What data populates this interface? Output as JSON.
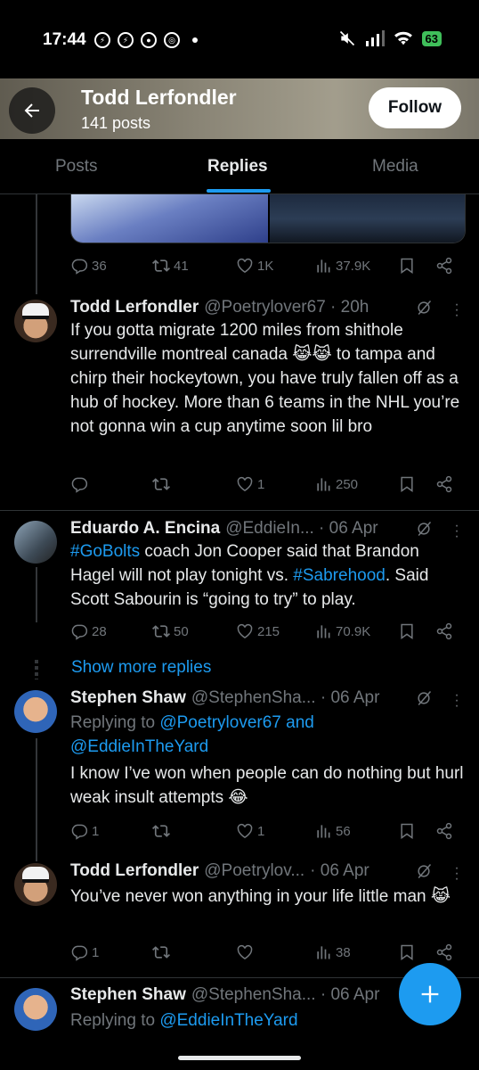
{
  "status_bar": {
    "time": "17:44",
    "battery": "63"
  },
  "header": {
    "name": "Todd Lerfondler",
    "post_count": "141 posts",
    "follow_label": "Follow"
  },
  "tabs": [
    {
      "label": "Posts",
      "active": false
    },
    {
      "label": "Replies",
      "active": true
    },
    {
      "label": "Media",
      "active": false
    }
  ],
  "posts": [
    {
      "stats": {
        "replies": "36",
        "reposts": "41",
        "likes": "1K",
        "views": "37.9K"
      }
    },
    {
      "name": "Todd Lerfondler",
      "handle": "@Poetrylover67 · 20h",
      "text": "If you gotta migrate 1200 miles from shithole surrendville montreal canada 😹😹 to tampa and chirp their hockeytown, you have truly fallen off as a hub of hockey. More than 6 teams in the NHL you’re not gonna win a cup anytime soon lil bro",
      "stats": {
        "replies": "",
        "reposts": "",
        "likes": "1",
        "views": "250"
      }
    },
    {
      "name": "Eduardo A. Encina",
      "handle": "@EddieIn... · 06 Apr",
      "text_parts": {
        "hashtag1": "#GoBolts",
        "part1": " coach Jon Cooper said that Brandon Hagel will not play tonight vs. ",
        "hashtag2": "#Sabrehood",
        "part2": ". Said Scott Sabourin is “going to try” to play."
      },
      "stats": {
        "replies": "28",
        "reposts": "50",
        "likes": "215",
        "views": "70.9K"
      }
    },
    {
      "name": "Stephen Shaw",
      "handle": "@StephenSha... · 06 Apr",
      "replying_prefix": "Replying to ",
      "replying_user1": "@Poetrylover67",
      "replying_and": " and",
      "replying_user2": "@EddieInTheYard",
      "text": "I know I’ve won when people can do nothing but hurl weak insult attempts 😂",
      "stats": {
        "replies": "1",
        "reposts": "",
        "likes": "1",
        "views": "56"
      }
    },
    {
      "name": "Todd Lerfondler",
      "handle": "@Poetrylov...",
      "date": "· 06 Apr",
      "text": "You’ve never won anything in your life little man 😹",
      "stats": {
        "replies": "1",
        "reposts": "",
        "likes": "",
        "views": "38"
      }
    },
    {
      "name": "Stephen Shaw",
      "handle": "@StephenSha... · 06 Apr",
      "replying_prefix": "Replying to ",
      "replying_user": "@EddieInTheYard"
    }
  ],
  "show_more_label": "Show more replies",
  "colors": {
    "accent": "#1d9bf0",
    "muted": "#71767b",
    "text": "#e7e9ea",
    "background": "#000000"
  },
  "icons": [
    "back-arrow-icon",
    "reply-icon",
    "repost-icon",
    "like-icon",
    "views-icon",
    "bookmark-icon",
    "share-icon",
    "grok-icon",
    "more-icon",
    "compose-plus-icon"
  ]
}
